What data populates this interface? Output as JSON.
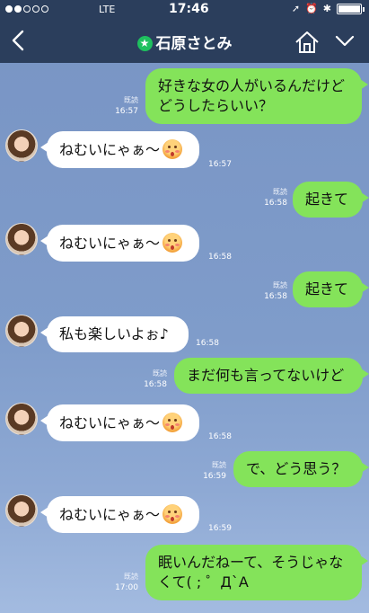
{
  "status_bar": {
    "carrier": "LTE",
    "time": "17:46"
  },
  "header": {
    "contact_name": "石原さとみ",
    "star_icon": "★"
  },
  "messages": [
    {
      "side": "right",
      "text_lines": [
        "好きな女の人がいるんだけど",
        "どうしたらいい？"
      ],
      "read": "既読",
      "time": "16:57"
    },
    {
      "side": "left",
      "text": "ねむいにゃぁ〜",
      "emoji": "blush-face-emoji",
      "time": "16:57"
    },
    {
      "side": "right",
      "text": "起きて",
      "read": "既読",
      "time": "16:58"
    },
    {
      "side": "left",
      "text": "ねむいにゃぁ〜",
      "emoji": "blush-face-emoji",
      "time": "16:58"
    },
    {
      "side": "right",
      "text": "起きて",
      "read": "既読",
      "time": "16:58"
    },
    {
      "side": "left",
      "text": "私も楽しいよぉ♪",
      "time": "16:58"
    },
    {
      "side": "right",
      "text": "まだ何も言ってないけど",
      "read": "既読",
      "time": "16:58"
    },
    {
      "side": "left",
      "text": "ねむいにゃぁ〜",
      "emoji": "blush-face-emoji",
      "time": "16:58"
    },
    {
      "side": "right",
      "text": "で、どう思う？",
      "read": "既読",
      "time": "16:59"
    },
    {
      "side": "left",
      "text": "ねむいにゃぁ〜",
      "emoji": "blush-face-emoji",
      "time": "16:59"
    },
    {
      "side": "right",
      "text_lines": [
        "眠いんだねーて、そうじゃな",
        "くて( ; ゜Д`A"
      ],
      "read": "既読",
      "time": "17:00"
    }
  ],
  "colors": {
    "header_bg": "#2b3e5c",
    "chat_bg": "#7e9bc8",
    "sent_bubble": "#84e35a",
    "received_bubble": "#ffffff",
    "official_badge": "#1ec05e"
  }
}
